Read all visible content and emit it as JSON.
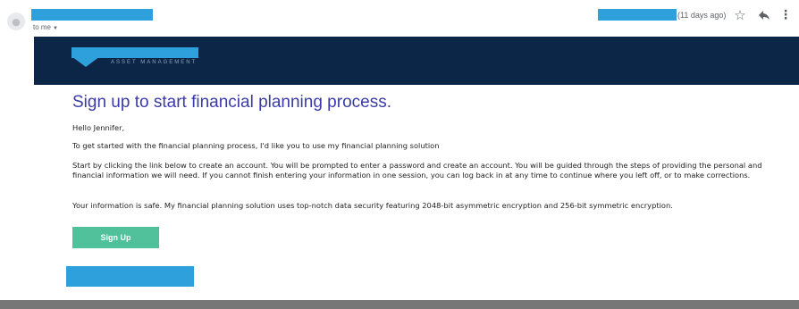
{
  "header": {
    "recipient_label": "to me",
    "date_relative": "(11 days ago)"
  },
  "banner": {
    "logo_text": "ASSET MANAGEMENT",
    "background_color": "#0c2647",
    "accent_color": "#2ea1dc"
  },
  "email": {
    "headline": "Sign up to start financial planning process.",
    "greeting": "Hello Jennifer,",
    "intro": "To get started with the financial planning process, I'd like you to use my financial planning solution",
    "instructions": "Start by clicking the link below to create an account. You will be prompted to enter a password and create an account. You will be guided through the steps of providing the personal and financial information we will need. If you cannot finish entering your information in one session, you can log back in at any time to continue where you left off, or to make corrections.",
    "security": "Your information is safe. My financial planning solution uses top-notch data security featuring 2048-bit asymmetric encryption and 256-bit symmetric encryption.",
    "signup_label": "Sign Up",
    "signup_color": "#50c19a",
    "headline_color": "#3b3ba7"
  },
  "icons": {
    "avatar": "person-icon",
    "star": "star-icon",
    "reply": "reply-icon",
    "more": "more-vert-icon",
    "dropdown": "caret-down-icon"
  }
}
